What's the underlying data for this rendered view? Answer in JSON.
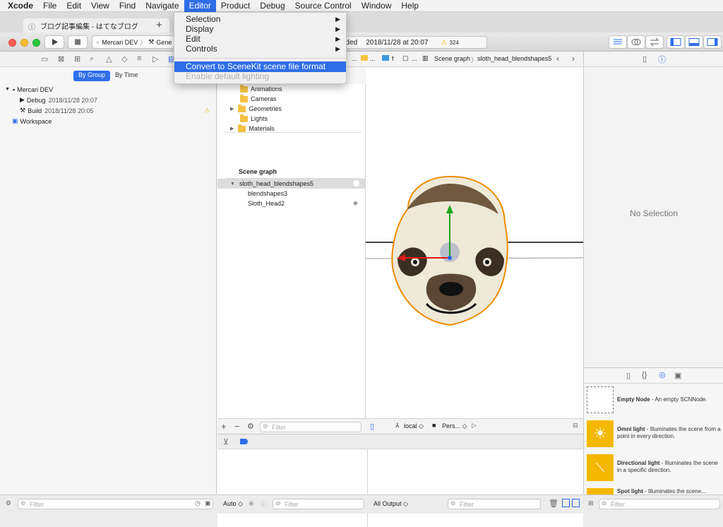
{
  "menubar": {
    "items": [
      "Xcode",
      "File",
      "Edit",
      "View",
      "Find",
      "Navigate",
      "Editor",
      "Product",
      "Debug",
      "Source Control",
      "Window",
      "Help"
    ],
    "active": "Editor"
  },
  "safari_tab": {
    "title": "ブログ記事編集 - はてなブログ"
  },
  "toolbar": {
    "scheme": "Mercari DEV",
    "destination": "Gene",
    "status_partial": "eded",
    "status_time": "2018/11/28 at 20:07",
    "warning_count": "324"
  },
  "navigator": {
    "segments": [
      "By Group",
      "By Time"
    ],
    "selected_segment": "By Group",
    "rows": [
      {
        "label": "Mercari DEV",
        "detail": ""
      },
      {
        "label": "Debug",
        "detail": "2018/11/28 20:07"
      },
      {
        "label": "Build",
        "detail": "2018/11/28 20:05"
      },
      {
        "label": "Workspace",
        "detail": ""
      }
    ],
    "filter_placeholder": "Filter"
  },
  "editor_menu": {
    "items": [
      {
        "label": "Selection",
        "submenu": true,
        "enabled": true
      },
      {
        "label": "Display",
        "submenu": true,
        "enabled": true
      },
      {
        "label": "Edit",
        "submenu": true,
        "enabled": true
      },
      {
        "label": "Controls",
        "submenu": true,
        "enabled": true
      },
      {
        "label": "Convert to SceneKit scene file format (.scn)",
        "submenu": false,
        "enabled": true,
        "highlighted": true
      },
      {
        "label": "Enable default lighting",
        "submenu": false,
        "enabled": false
      }
    ]
  },
  "jumpbar": {
    "crumbs": [
      "...",
      "...",
      "f",
      "...",
      "Scene graph",
      "sloth_head_blendshapes5"
    ]
  },
  "outline": {
    "library_items": [
      "Animations",
      "Cameras",
      "Geometries",
      "Lights",
      "Materials"
    ],
    "scene_graph_title": "Scene graph",
    "nodes": [
      "sloth_head_blendshapes5",
      "blendshapes3",
      "Sloth_Head2"
    ],
    "filter_placeholder": "Filter"
  },
  "scene_controls": {
    "coordinate_space": "local",
    "camera": "Pers..."
  },
  "debug": {
    "auto_label": "Auto",
    "all_output_label": "All Output",
    "filter_placeholder": "Filter"
  },
  "inspector": {
    "empty_label": "No Selection"
  },
  "library": {
    "items": [
      {
        "title": "Empty Node",
        "desc": " - An empty SCNNode."
      },
      {
        "title": "Omni light",
        "desc": " - Illuminates the scene from a point in every direction."
      },
      {
        "title": "Directional light",
        "desc": " - Illuminates the scene in a specific direction."
      },
      {
        "title": "Spot light",
        "desc": " - Illuminates the scene..."
      }
    ],
    "filter_placeholder": "Filter"
  },
  "colors": {
    "accent": "#2f6ee9",
    "light_icon": "#f5b800",
    "warning": "#f0b400"
  }
}
